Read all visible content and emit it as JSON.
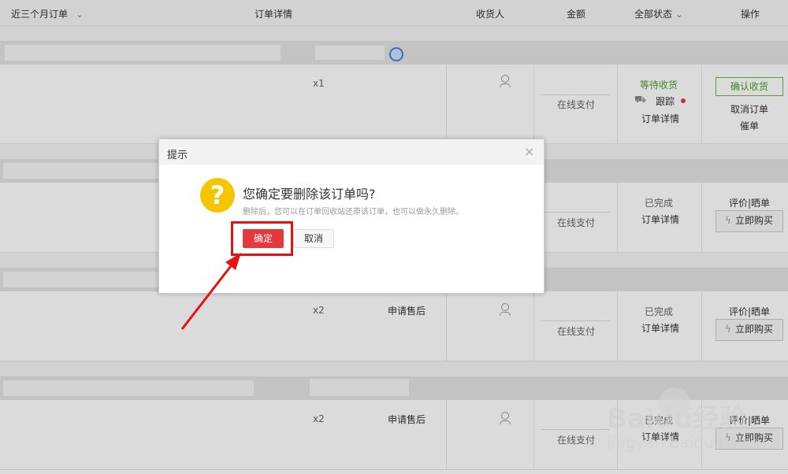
{
  "header": {
    "range_label": "近三个月订单",
    "detail_label": "订单详情",
    "receiver_label": "收货人",
    "amount_label": "金额",
    "status_label": "全部状态",
    "action_label": "操作"
  },
  "orders": [
    {
      "qty": "x1",
      "payment": "在线支付",
      "status": "等待收货",
      "track": "跟踪",
      "detail": "订单详情",
      "confirm_button": "确认收货",
      "cancel_link": "取消订单",
      "urge_link": "催单"
    },
    {
      "payment": "在线支付",
      "status": "已完成",
      "detail": "订单详情",
      "review_link": "评价|晒单",
      "buy_button": "立即购买"
    },
    {
      "qty": "x2",
      "after_sale": "申请售后",
      "payment": "在线支付",
      "status": "已完成",
      "detail": "订单详情",
      "review_link": "评价|晒单",
      "buy_button": "立即购买"
    },
    {
      "qty": "x2",
      "after_sale": "申请售后",
      "payment": "在线支付",
      "status": "已完成",
      "detail": "订单详情",
      "review_link": "评价|晒单",
      "buy_button": "立即购买"
    }
  ],
  "dialog": {
    "title": "提示",
    "question": "您确定要删除该订单吗?",
    "hint": "删除后，您可以在订单回收站还原该订单，也可以做永久删除。",
    "ok_label": "确定",
    "cancel_label": "取消"
  },
  "watermark": {
    "brand": "Baidu经验",
    "url": "jingyan.baidu.com"
  },
  "colors": {
    "accent": "#e4393c",
    "status_green": "#4a9e2f",
    "warning": "#f5c500",
    "annotation": "#e8110f"
  }
}
